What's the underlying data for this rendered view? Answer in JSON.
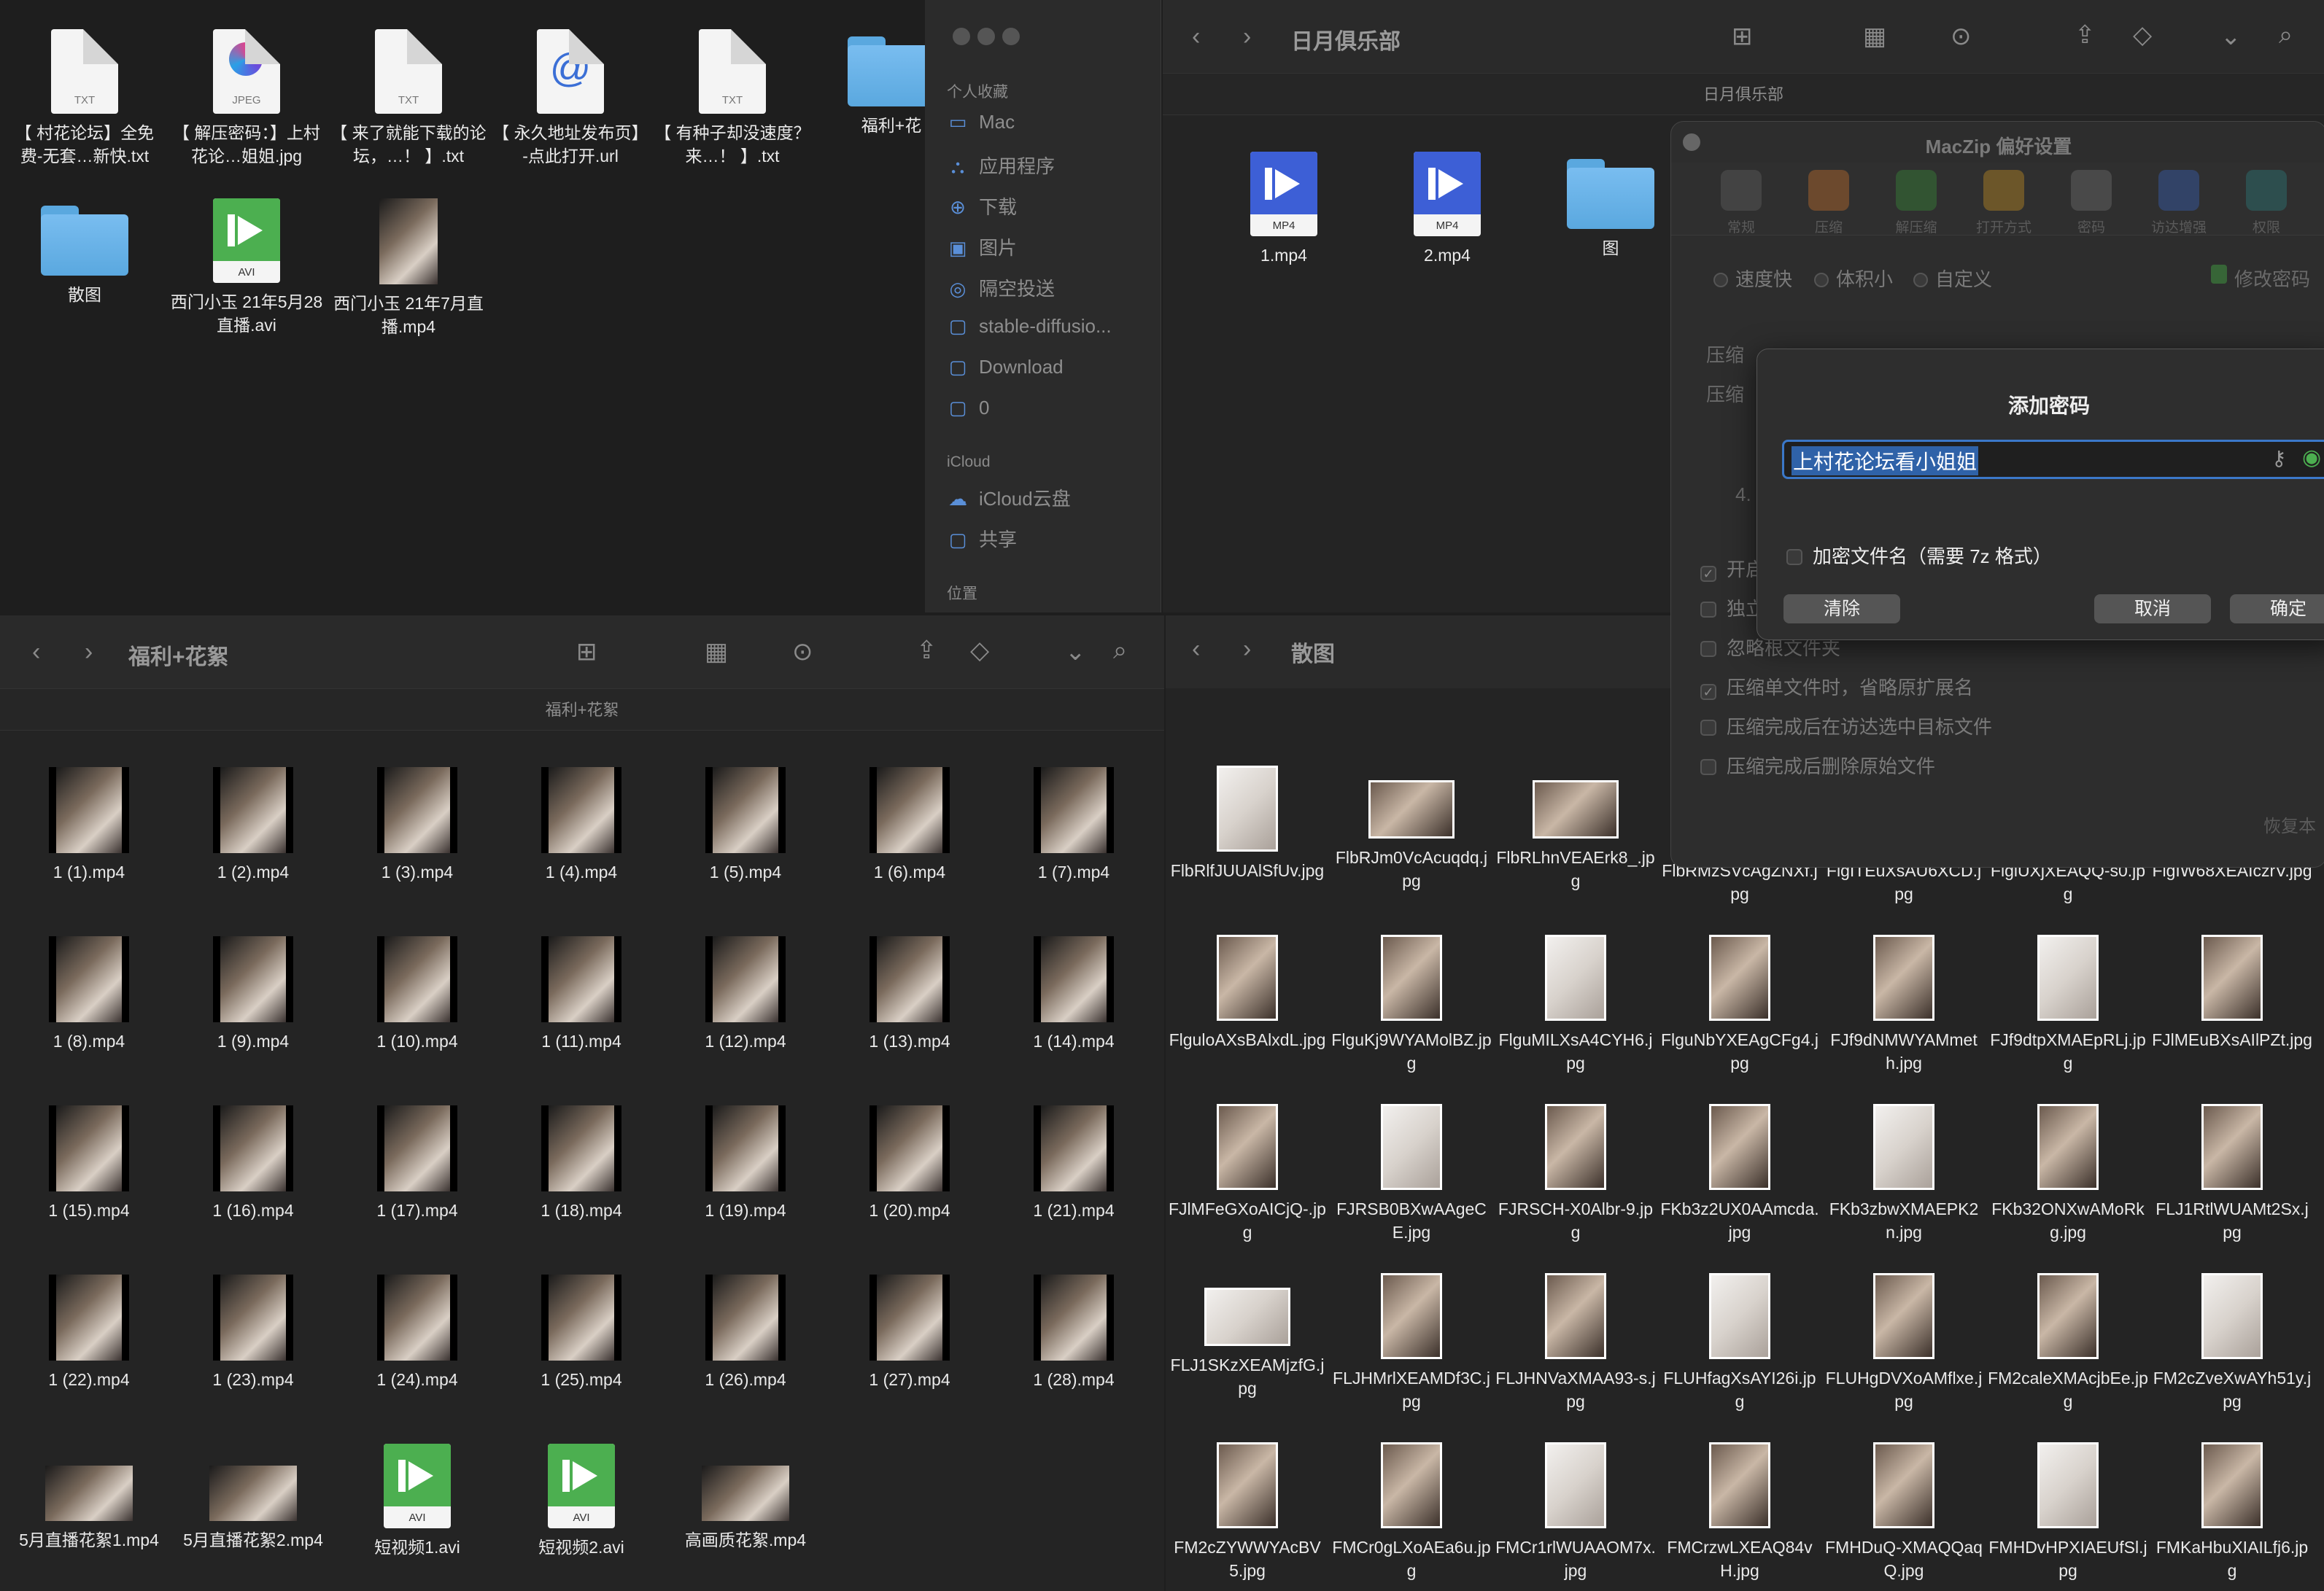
{
  "desktop_files": [
    {
      "label": "【 村花论坛】全免费-无套…新快.txt",
      "kind": "txt",
      "ext": "TXT"
    },
    {
      "label": "【 解压密码：】上村花论…姐姐.jpg",
      "kind": "jpeg",
      "ext": "JPEG"
    },
    {
      "label": "【 来了就能下载的论坛，…！ 】.txt",
      "kind": "txt",
      "ext": "TXT"
    },
    {
      "label": "【 永久地址发布页】-点此打开.url",
      "kind": "url",
      "ext": "@"
    },
    {
      "label": "【 有种子却没速度？来…！ 】.txt",
      "kind": "txt",
      "ext": "TXT"
    },
    {
      "label": "福利+花",
      "kind": "folder"
    },
    {
      "label": "散图",
      "kind": "folder"
    },
    {
      "label": "西门小玉 21年5月28直播.avi",
      "kind": "avi",
      "ext": "AVI"
    },
    {
      "label": "西门小玉 21年7月直播.mp4",
      "kind": "photo"
    }
  ],
  "sidebar": {
    "section_favorites": "个人收藏",
    "favorites": [
      {
        "label": "Mac",
        "icon": "drive-icon"
      },
      {
        "label": "应用程序",
        "icon": "apps-icon"
      },
      {
        "label": "下载",
        "icon": "download-icon"
      },
      {
        "label": "图片",
        "icon": "pictures-icon"
      },
      {
        "label": "隔空投送",
        "icon": "airdrop-icon"
      },
      {
        "label": "stable-diffusio...",
        "icon": "folder-icon"
      },
      {
        "label": "Download",
        "icon": "folder-icon"
      },
      {
        "label": "0",
        "icon": "folder-icon"
      }
    ],
    "section_icloud": "iCloud",
    "icloud": [
      {
        "label": "iCloud云盘",
        "icon": "cloud-icon"
      },
      {
        "label": "共享",
        "icon": "shared-folder-icon"
      }
    ],
    "section_locations": "位置"
  },
  "win_top": {
    "title": "日月俱乐部",
    "path": "日月俱乐部",
    "files": [
      {
        "label": "1.mp4",
        "ext": "MP4"
      },
      {
        "label": "2.mp4",
        "ext": "MP4"
      },
      {
        "label": "图",
        "kind": "folder"
      }
    ]
  },
  "prefs": {
    "title": "MacZip 偏好设置",
    "tabs": [
      "常规",
      "压缩",
      "解压缩",
      "打开方式",
      "密码",
      "访达增强",
      "权限"
    ],
    "radios": [
      "速度快",
      "体积小",
      "自定义"
    ],
    "lock_label": "修改密码",
    "row_labels": [
      "压缩",
      "压缩",
      "4."
    ],
    "checks": [
      {
        "label": "开启",
        "checked": true
      },
      {
        "label": "独立",
        "checked": false
      },
      {
        "label": "忽略根文件夹",
        "checked": false
      },
      {
        "label": "压缩单文件时，省略原扩展名",
        "checked": true
      },
      {
        "label": "压缩完成后在访达选中目标文件",
        "checked": false
      },
      {
        "label": "压缩完成后删除原始文件",
        "checked": false
      }
    ],
    "restore": "恢复本"
  },
  "dialog": {
    "title": "添加密码",
    "password_value": "上村花论坛看小姐姐",
    "encrypt_names": "加密文件名（需要 7z 格式）",
    "clear": "清除",
    "cancel": "取消",
    "ok": "确定"
  },
  "win_left": {
    "title": "福利+花絮",
    "path": "福利+花絮",
    "files": [
      "1 (1).mp4",
      "1 (2).mp4",
      "1 (3).mp4",
      "1 (4).mp4",
      "1 (5).mp4",
      "1 (6).mp4",
      "1 (7).mp4",
      "1 (8).mp4",
      "1 (9).mp4",
      "1 (10).mp4",
      "1 (11).mp4",
      "1 (12).mp4",
      "1 (13).mp4",
      "1 (14).mp4",
      "1 (15).mp4",
      "1 (16).mp4",
      "1 (17).mp4",
      "1 (18).mp4",
      "1 (19).mp4",
      "1 (20).mp4",
      "1 (21).mp4",
      "1 (22).mp4",
      "1 (23).mp4",
      "1 (24).mp4",
      "1 (25).mp4",
      "1 (26).mp4",
      "1 (27).mp4",
      "1 (28).mp4",
      "5月直播花絮1.mp4",
      "5月直播花絮2.mp4",
      "短视频1.avi",
      "短视频2.avi",
      "高画质花絮.mp4"
    ]
  },
  "win_right": {
    "title": "散图",
    "files": [
      "FlbRlfJUUAlSfUv.jpg",
      "FlbRJm0VcAcuqdq.jpg",
      "FlbRLhnVEAErk8_.jpg",
      "FlbRMzSVcAgZNXf.jpg",
      "FlgITEuXsAU6XCD.jpg",
      "FlglUXjXEAQQ-s0.jpg",
      "FlgIW68XEAIczrV.jpg",
      "FlguloAXsBAlxdL.jpg",
      "FlguKj9WYAMolBZ.jpg",
      "FlguMILXsA4CYH6.jpg",
      "FlguNbYXEAgCFg4.jpg",
      "FJf9dNMWYAMmeth.jpg",
      "FJf9dtpXMAEpRLj.jpg",
      "FJlMEuBXsAIlPZt.jpg",
      "FJlMFeGXoAICjQ-.jpg",
      "FJRSB0BXwAAgeCE.jpg",
      "FJRSCH-X0Albr-9.jpg",
      "FKb3z2UX0AAmcda.jpg",
      "FKb3zbwXMAEPK2n.jpg",
      "FKb32ONXwAMoRkg.jpg",
      "FLJ1RtlWUAMt2Sx.jpg",
      "FLJ1SKzXEAMjzfG.jpg",
      "FLJHMrlXEAMDf3C.jpg",
      "FLJHNVaXMAA93-s.jpg",
      "FLUHfagXsAYI26i.jpg",
      "FLUHgDVXoAMflxe.jpg",
      "FM2caleXMAcjbEe.jpg",
      "FM2cZveXwAYh51y.jpg",
      "FM2cZYWWYAcBV5.jpg",
      "FMCr0gLXoAEa6u.jpg",
      "FMCr1rlWUAAOM7x.jpg",
      "FMCrzwLXEAQ84vH.jpg",
      "FMHDuQ-XMAQQaqQ.jpg",
      "FMHDvHPXIAEUfSl.jpg",
      "FMKaHbuXIAILfj6.jpg"
    ]
  }
}
